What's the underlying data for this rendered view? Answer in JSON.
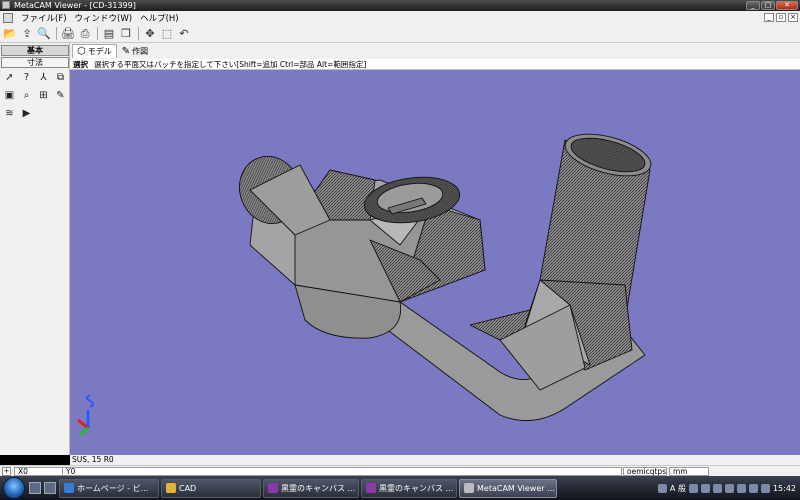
{
  "window": {
    "title": "MetaCAM Viewer - [CD-31399]"
  },
  "menu": {
    "items": [
      "ファイル(F)",
      "ウィンドウ(W)",
      "ヘルプ(H)"
    ]
  },
  "toolbar": {
    "icons": [
      "open-icon",
      "export-icon",
      "zoom-document-icon",
      "print-icon",
      "print-preview-icon",
      "properties-icon",
      "copy-document-icon",
      "pan-icon",
      "zoom-window-icon",
      "undo-view-icon"
    ]
  },
  "sidebar": {
    "tab_basic": "基本",
    "tab_dimension": "寸法",
    "tools": [
      "select-arrow-icon",
      "query-arrow-icon",
      "measure-compass-icon",
      "copy-view-icon",
      "display-panel-icon",
      "magnifier-icon",
      "grid-icon",
      "note-icon",
      "layers-icon",
      "play-icon"
    ]
  },
  "tabs": [
    {
      "label": "モデル",
      "selected": true
    },
    {
      "label": "作図",
      "selected": false
    }
  ],
  "prompt": {
    "mode": "選択",
    "message": "選択する平面又はパッチを指定して下さい[Shift=追加 Ctrl=部品 Alt=範囲指定]"
  },
  "material": "SUS, 15 R0",
  "coords": {
    "x": "X0",
    "y": "Y0",
    "layer": "oemicqtps",
    "unit": "mm"
  },
  "taskbar": {
    "tasks": [
      {
        "label": "ホームページ - ビ...",
        "color": "#3a7bd5",
        "active": false
      },
      {
        "label": "CAD",
        "color": "#e2b53a",
        "active": false
      },
      {
        "label": "黒霊のキャンバス ...",
        "color": "#8a3aa8",
        "active": false
      },
      {
        "label": "黒霊のキャンバス ...",
        "color": "#8a3aa8",
        "active": false
      },
      {
        "label": "MetaCAM Viewer ...",
        "color": "#bcbcbc",
        "active": true
      }
    ],
    "ime": "A 般",
    "clock": "15:42"
  },
  "colors": {
    "viewport_bg": "#7b79c1",
    "part_fill": "#9a9a9a"
  }
}
